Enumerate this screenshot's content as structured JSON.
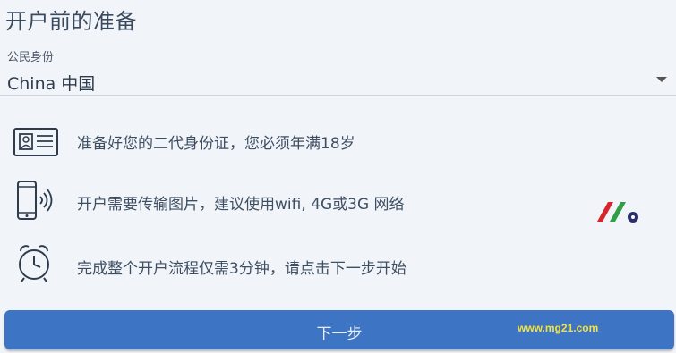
{
  "page": {
    "title": "开户前的准备"
  },
  "citizenship": {
    "label": "公民身份",
    "value": "China 中国"
  },
  "requirements": [
    {
      "icon": "id-card-icon",
      "text": "准备好您的二代身份证，您必须年满18岁"
    },
    {
      "icon": "phone-signal-icon",
      "text": "开户需要传输图片，建议使用wifi, 4G或3G 网络"
    },
    {
      "icon": "alarm-clock-icon",
      "text": "完成整个开户流程仅需3分钟，请点击下一步开始"
    }
  ],
  "buttons": {
    "next_label": "下一步"
  },
  "watermark": "www.mg21.com",
  "colors": {
    "button": "#3d74c4",
    "watermark": "#f3e23a",
    "logo_red": "#d6262b",
    "logo_green": "#2f9e44",
    "logo_navy": "#2a2d6e"
  }
}
